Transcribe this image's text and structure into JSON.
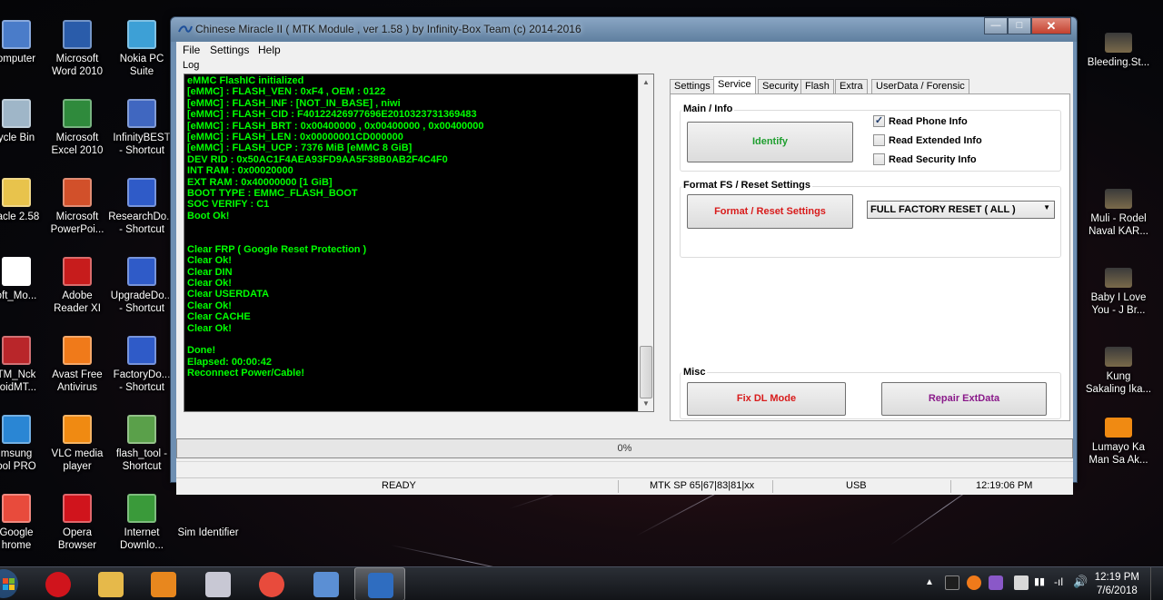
{
  "desktop": {
    "icons": [
      {
        "label": "omputer",
        "icon": "computer-icon",
        "color": "#4a7cc9"
      },
      {
        "label": "Microsoft\nWord 2010",
        "icon": "word-icon",
        "color": "#2a5caa"
      },
      {
        "label": "Nokia PC\nSuite",
        "icon": "nokia-pc-suite-icon",
        "color": "#3da0d6"
      },
      {
        "label": "ycle Bin",
        "icon": "recycle-bin-icon",
        "color": "#9fb6c8"
      },
      {
        "label": "Microsoft\nExcel 2010",
        "icon": "excel-icon",
        "color": "#2f8a3c"
      },
      {
        "label": "InfinityBEST\n- Shortcut",
        "icon": "infinitybest-icon",
        "color": "#4067c0"
      },
      {
        "label": "racle 2.58",
        "icon": "folder-icon",
        "color": "#e8c34c"
      },
      {
        "label": "Microsoft\nPowerPoi...",
        "icon": "powerpoint-icon",
        "color": "#d2502a"
      },
      {
        "label": "ResearchDo...\n- Shortcut",
        "icon": "researchdownload-icon",
        "color": "#2f5bc8"
      },
      {
        "label": "oft_Mo...",
        "icon": "r-logo-icon",
        "color": "#ffffff"
      },
      {
        "label": "Adobe\nReader XI",
        "icon": "adobe-reader-icon",
        "color": "#c71c1c"
      },
      {
        "label": "UpgradeDo...\n- Shortcut",
        "icon": "upgradedownload-icon",
        "color": "#2f5bc8"
      },
      {
        "label": "TM_Nck\nroidMT...",
        "icon": "nck-icon",
        "color": "#b9262a"
      },
      {
        "label": "Avast Free\nAntivirus",
        "icon": "avast-icon",
        "color": "#f07a1a"
      },
      {
        "label": "FactoryDo...\n- Shortcut",
        "icon": "factorydownload-icon",
        "color": "#2f5bc8"
      },
      {
        "label": "msung\nool PRO",
        "icon": "samsung-tool-icon",
        "color": "#2a86d4"
      },
      {
        "label": "VLC media\nplayer",
        "icon": "vlc-icon",
        "color": "#f08a12"
      },
      {
        "label": "flash_tool -\nShortcut",
        "icon": "flash-tool-icon",
        "color": "#5aa04a"
      },
      {
        "label": "Google\nhrome",
        "icon": "chrome-icon",
        "color": "#e84b3c"
      },
      {
        "label": "Opera\nBrowser",
        "icon": "opera-icon",
        "color": "#d0141c"
      },
      {
        "label": "Internet\nDownlo...",
        "icon": "internet-download-manager-icon",
        "color": "#3a9a3a"
      },
      {
        "label": "Sim Identifier",
        "icon": "",
        "color": ""
      }
    ],
    "right_icons": [
      {
        "label": "Bleeding.St...",
        "icon": "video-thumbnail-icon"
      },
      {
        "label": "Muli - Rodel\nNaval KAR...",
        "icon": "video-thumbnail-icon"
      },
      {
        "label": "Baby I Love\nYou - J Br...",
        "icon": "video-thumbnail-icon"
      },
      {
        "label": "Kung\nSakaling Ika...",
        "icon": "video-thumbnail-icon"
      },
      {
        "label": "Lumayo Ka\nMan Sa Ak...",
        "icon": "vlc-icon"
      }
    ]
  },
  "window": {
    "title": "Chinese Miracle II ( MTK Module , ver 1.58 ) by Infinity-Box Team (c) 2014-2016",
    "menu": [
      "File",
      "Settings",
      "Help"
    ],
    "log_label": "Log",
    "log_lines": [
      "eMMC FlashIC initialized",
      "[eMMC] : FLASH_VEN : 0xF4 , OEM : 0122",
      "[eMMC] : FLASH_INF : [NOT_IN_BASE] , niwi",
      "[eMMC] : FLASH_CID : F40122426977696E2010323731369483",
      "[eMMC] : FLASH_BRT : 0x00400000 , 0x00400000 , 0x00400000",
      "[eMMC] : FLASH_LEN : 0x00000001CD000000",
      "[eMMC] : FLASH_UCP : 7376 MiB [eMMC 8 GiB]",
      "DEV RID  : 0x50AC1F4AEA93FD9AA5F38B0AB2F4C4F0",
      "INT RAM   : 0x00020000",
      "EXT RAM   : 0x40000000 [1 GiB]",
      "BOOT TYPE  : EMMC_FLASH_BOOT",
      "SOC VERIFY : C1",
      "Boot Ok!",
      "",
      "",
      "Clear FRP ( Google Reset Protection )",
      "Clear Ok!",
      "Clear DIN",
      "Clear Ok!",
      "Clear USERDATA",
      "Clear Ok!",
      "Clear CACHE",
      "Clear Ok!",
      "",
      "Done!",
      "Elapsed: 00:00:42",
      "Reconnect Power/Cable!"
    ],
    "tabs": [
      "Settings",
      "Service",
      "Security",
      "Flash",
      "Extra",
      "UserData / Forensic"
    ],
    "active_tab": "Service",
    "main_info": {
      "title": "Main / Info",
      "identify_label": "Identify",
      "checkboxes": [
        {
          "label": "Read Phone Info",
          "checked": true
        },
        {
          "label": "Read Extended Info",
          "checked": false
        },
        {
          "label": "Read Security Info",
          "checked": false
        }
      ]
    },
    "format": {
      "title": "Format FS / Reset Settings",
      "button_label": "Format / Reset Settings",
      "select_value": "FULL FACTORY RESET ( ALL )"
    },
    "misc": {
      "title": "Misc",
      "fix_dl_label": "Fix DL Mode",
      "repair_label": "Repair ExtData"
    },
    "progress": {
      "percent": 0,
      "text": "0%"
    },
    "status": {
      "state": "READY",
      "platform": "MTK SP 65|67|83|81|xx",
      "port": "USB",
      "time": "12:19:06 PM"
    },
    "colors": {
      "log_text": "#00ff00",
      "identify_text": "#1e9e2e",
      "format_text": "#d81b1b",
      "fix_dl_text": "#d81b1b",
      "repair_text": "#8a1a8a"
    }
  },
  "taskbar": {
    "apps": [
      {
        "name": "opera-icon",
        "color": "#d0141c"
      },
      {
        "name": "file-explorer-icon",
        "color": "#e6b94a"
      },
      {
        "name": "media-player-icon",
        "color": "#e8871e"
      },
      {
        "name": "snipping-tool-icon",
        "color": "#c8c8d4"
      },
      {
        "name": "chrome-icon",
        "color": "#e84b3c"
      },
      {
        "name": "remote-desktop-icon",
        "color": "#5b8fd4"
      },
      {
        "name": "chinese-miracle-icon",
        "color": "#2f6dc0"
      }
    ],
    "clock_time": "12:19 PM",
    "clock_date": "7/6/2018"
  }
}
